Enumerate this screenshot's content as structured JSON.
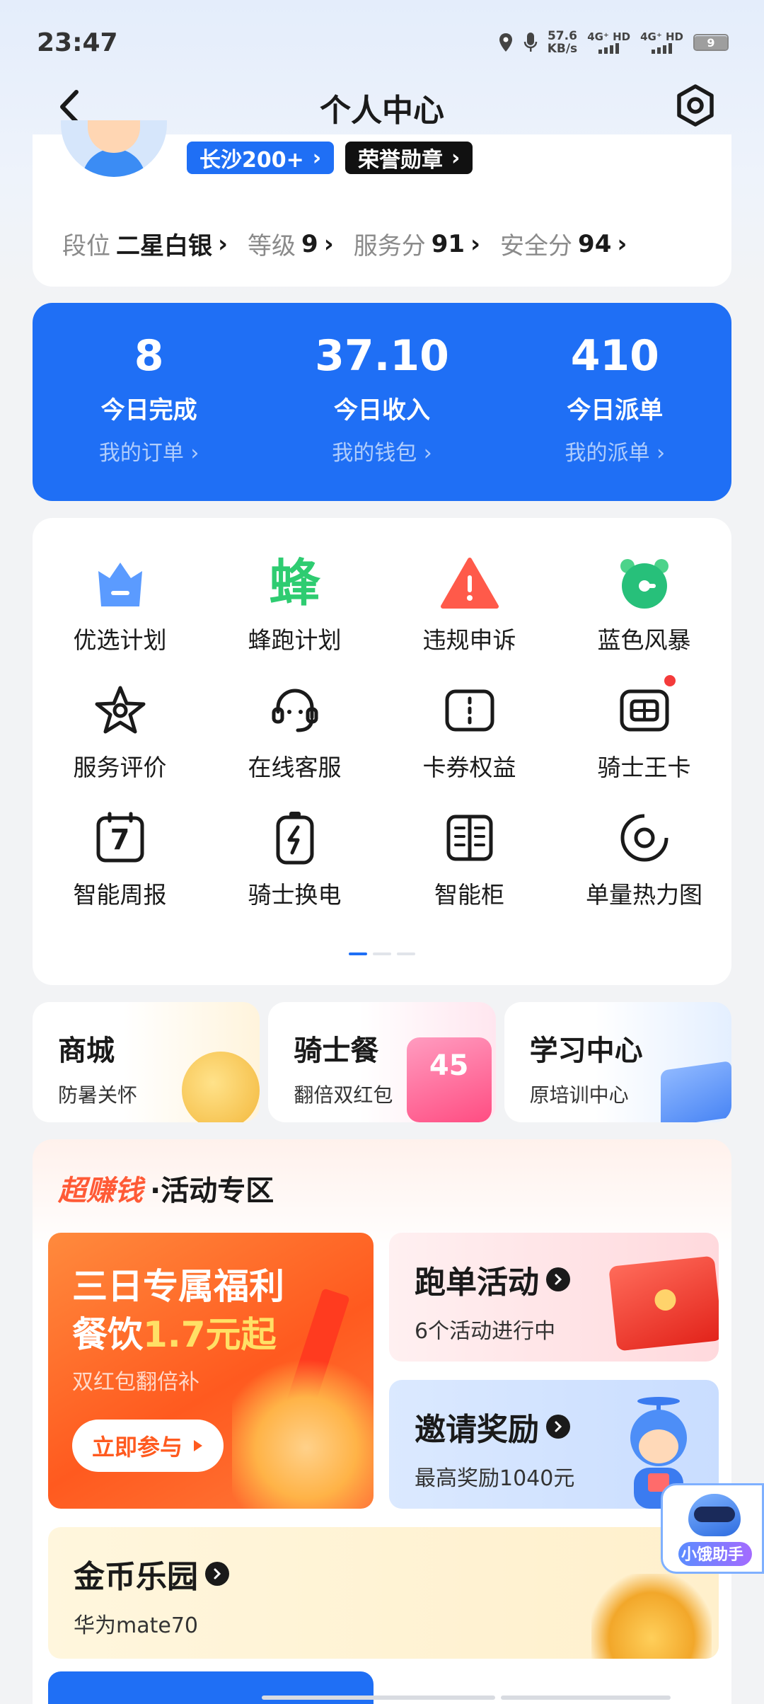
{
  "status_bar": {
    "time": "23:47",
    "net_speed_value": "57.6",
    "net_speed_unit": "KB/s",
    "sim1": "4G⁺ HD",
    "sim2": "4G⁺ HD",
    "battery": "9"
  },
  "header": {
    "title": "个人中心"
  },
  "profile": {
    "city_badge": "长沙200+",
    "honor_badge": "荣誉勋章",
    "stats": [
      {
        "label": "段位",
        "value": "二星白银"
      },
      {
        "label": "等级",
        "value": "9"
      },
      {
        "label": "服务分",
        "value": "91"
      },
      {
        "label": "安全分",
        "value": "94"
      }
    ]
  },
  "today": [
    {
      "value": "8",
      "label": "今日完成",
      "link": "我的订单"
    },
    {
      "value": "37.10",
      "label": "今日收入",
      "link": "我的钱包"
    },
    {
      "value": "410",
      "label": "今日派单",
      "link": "我的派单"
    }
  ],
  "tools": [
    {
      "label": "优选计划",
      "icon": "crown-icon"
    },
    {
      "label": "蜂跑计划",
      "icon": "bee-text-icon",
      "glyph": "蜂"
    },
    {
      "label": "违规申诉",
      "icon": "warning-icon"
    },
    {
      "label": "蓝色风暴",
      "icon": "alarm-clock-icon"
    },
    {
      "label": "服务评价",
      "icon": "star-icon"
    },
    {
      "label": "在线客服",
      "icon": "headset-icon"
    },
    {
      "label": "卡券权益",
      "icon": "coupon-icon"
    },
    {
      "label": "骑士王卡",
      "icon": "card-icon"
    },
    {
      "label": "智能周报",
      "icon": "calendar-icon",
      "glyph": "7"
    },
    {
      "label": "骑士换电",
      "icon": "battery-swap-icon"
    },
    {
      "label": "智能柜",
      "icon": "cabinet-icon"
    },
    {
      "label": "单量热力图",
      "icon": "target-icon"
    }
  ],
  "mini_cards": [
    {
      "title": "商城",
      "subtitle": "防暑关怀"
    },
    {
      "title": "骑士餐",
      "subtitle": "翻倍双红包",
      "badge": "45"
    },
    {
      "title": "学习中心",
      "subtitle": "原培训中心"
    }
  ],
  "activity": {
    "hot_label": "超赚钱",
    "title": "·活动专区",
    "promo": {
      "line1": "三日专属福利",
      "line2_prefix": "餐饮",
      "line2_highlight": "1.7元起",
      "subtitle": "双红包翻倍补",
      "button": "立即参与"
    },
    "run": {
      "title": "跑单活动",
      "subtitle": "6个活动进行中"
    },
    "invite": {
      "title": "邀请奖励",
      "subtitle": "最高奖励1040元"
    },
    "coin_park": {
      "title": "金币乐园",
      "subtitle": "华为mate70"
    }
  },
  "assistant": {
    "label": "小饿助手"
  },
  "colors": {
    "primary": "#1f6ff5",
    "hot": "#ff5a36"
  }
}
